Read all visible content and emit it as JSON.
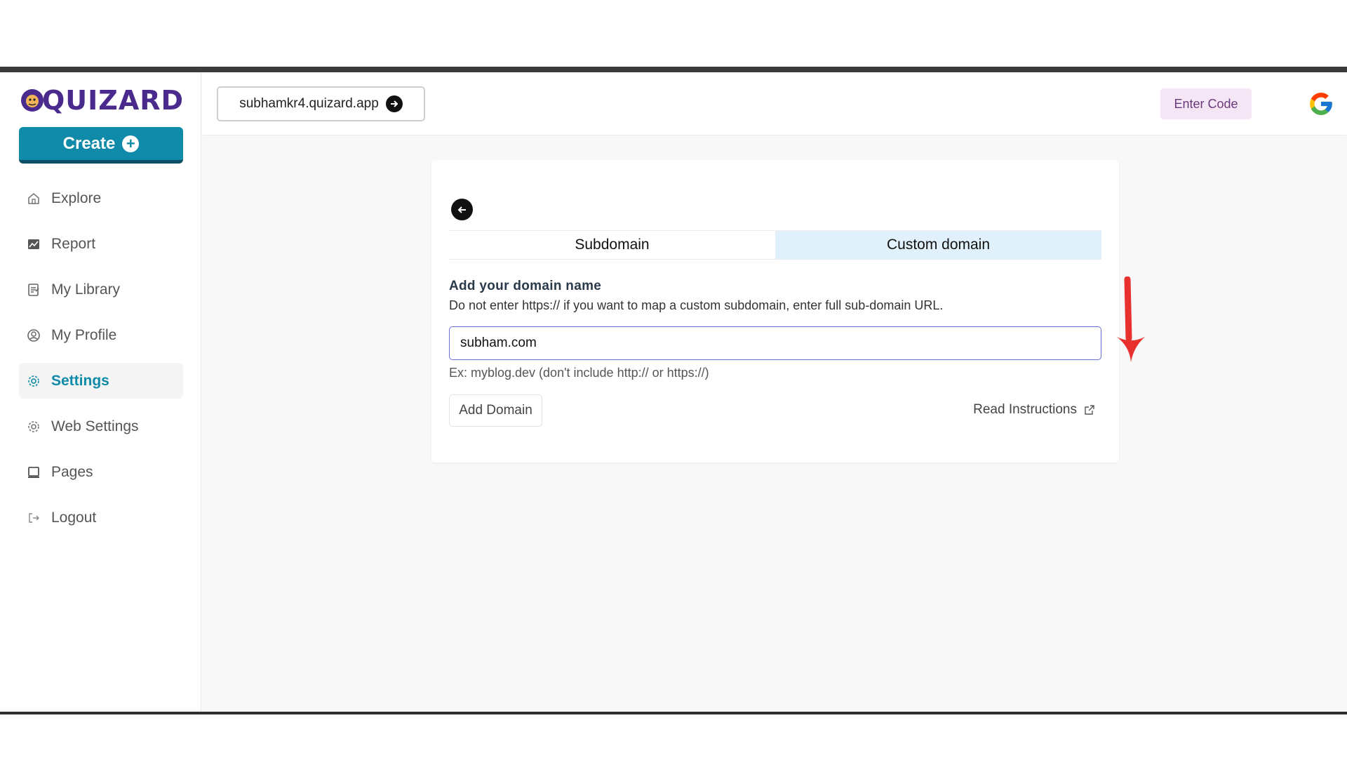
{
  "sidebar": {
    "logo_text": "QUIZARD",
    "create_label": "Create",
    "items": [
      {
        "label": "Explore",
        "icon": "home-icon",
        "active": false
      },
      {
        "label": "Report",
        "icon": "chart-icon",
        "active": false
      },
      {
        "label": "My Library",
        "icon": "library-icon",
        "active": false
      },
      {
        "label": "My Profile",
        "icon": "profile-icon",
        "active": false
      },
      {
        "label": "Settings",
        "icon": "gear-icon",
        "active": true
      },
      {
        "label": "Web Settings",
        "icon": "gear-icon",
        "active": false
      },
      {
        "label": "Pages",
        "icon": "pages-icon",
        "active": false
      },
      {
        "label": "Logout",
        "icon": "logout-icon",
        "active": false
      }
    ]
  },
  "header": {
    "domain": "subhamkr4.quizard.app",
    "enter_code": "Enter Code"
  },
  "card": {
    "tabs": [
      {
        "label": "Subdomain",
        "active": false
      },
      {
        "label": "Custom domain",
        "active": true
      }
    ],
    "field_label": "Add your domain name",
    "field_help": "Do not enter https:// if you want to map a custom subdomain, enter full sub-domain URL.",
    "input_value": "subham.com",
    "example": "Ex: myblog.dev (don't include http:// or https://)",
    "add_domain": "Add Domain",
    "read_instructions": "Read Instructions"
  },
  "colors": {
    "brand": "#0f8aa8",
    "active_tab": "#e0f1fb",
    "annotation": "#e8302f",
    "enter_code_bg": "#f5e6f5"
  }
}
